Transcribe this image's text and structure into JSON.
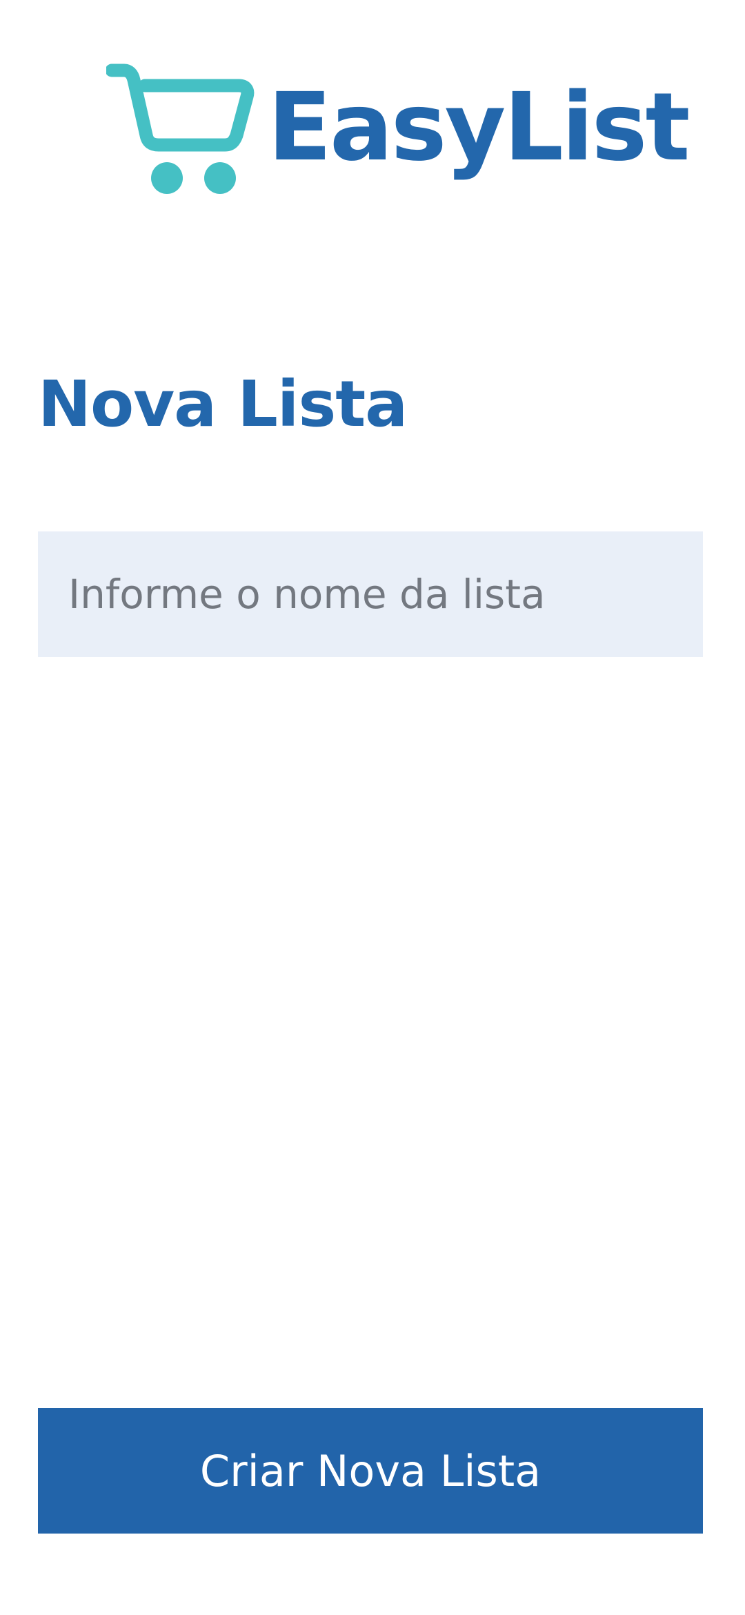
{
  "app": {
    "logo_text": "EasyList",
    "brand_color": "#2367ac",
    "accent_color": "#45c0c4",
    "logo_icon": "shopping-cart-icon"
  },
  "main": {
    "title": "Nova Lista",
    "list_name_input": {
      "value": "",
      "placeholder": "Informe o nome da lista"
    },
    "create_button_label": "Criar Nova Lista"
  }
}
